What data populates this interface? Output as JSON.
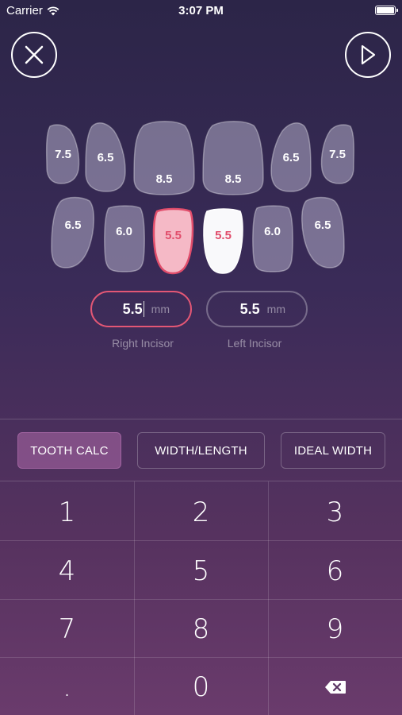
{
  "status_bar": {
    "carrier": "Carrier",
    "time": "3:07 PM"
  },
  "nav": {
    "close_icon": "close-icon",
    "play_icon": "play-icon"
  },
  "teeth": {
    "upper": [
      "7.5",
      "6.5",
      "8.5",
      "8.5",
      "6.5",
      "7.5"
    ],
    "lower": [
      "6.5",
      "6.0",
      "5.5",
      "5.5",
      "6.0",
      "6.5"
    ]
  },
  "inputs": {
    "right_incisor": {
      "value": "5.5",
      "unit": "mm",
      "caption": "Right Incisor"
    },
    "left_incisor": {
      "value": "5.5",
      "unit": "mm",
      "caption": "Left Incisor"
    }
  },
  "modes": {
    "tooth_calc": "TOOTH CALC",
    "width_length": "WIDTH/LENGTH",
    "ideal_width": "IDEAL WIDTH",
    "active": "TOOTH CALC"
  },
  "keypad": {
    "keys": [
      "1",
      "2",
      "3",
      "4",
      "5",
      "6",
      "7",
      "8",
      "9",
      ".",
      "0"
    ],
    "delete_icon": "backspace-icon"
  },
  "colors": {
    "accent_pink": "#e14d6b",
    "active_mode": "#a064a0",
    "background_top": "#2c2548",
    "background_bottom": "#6a3b6c"
  }
}
